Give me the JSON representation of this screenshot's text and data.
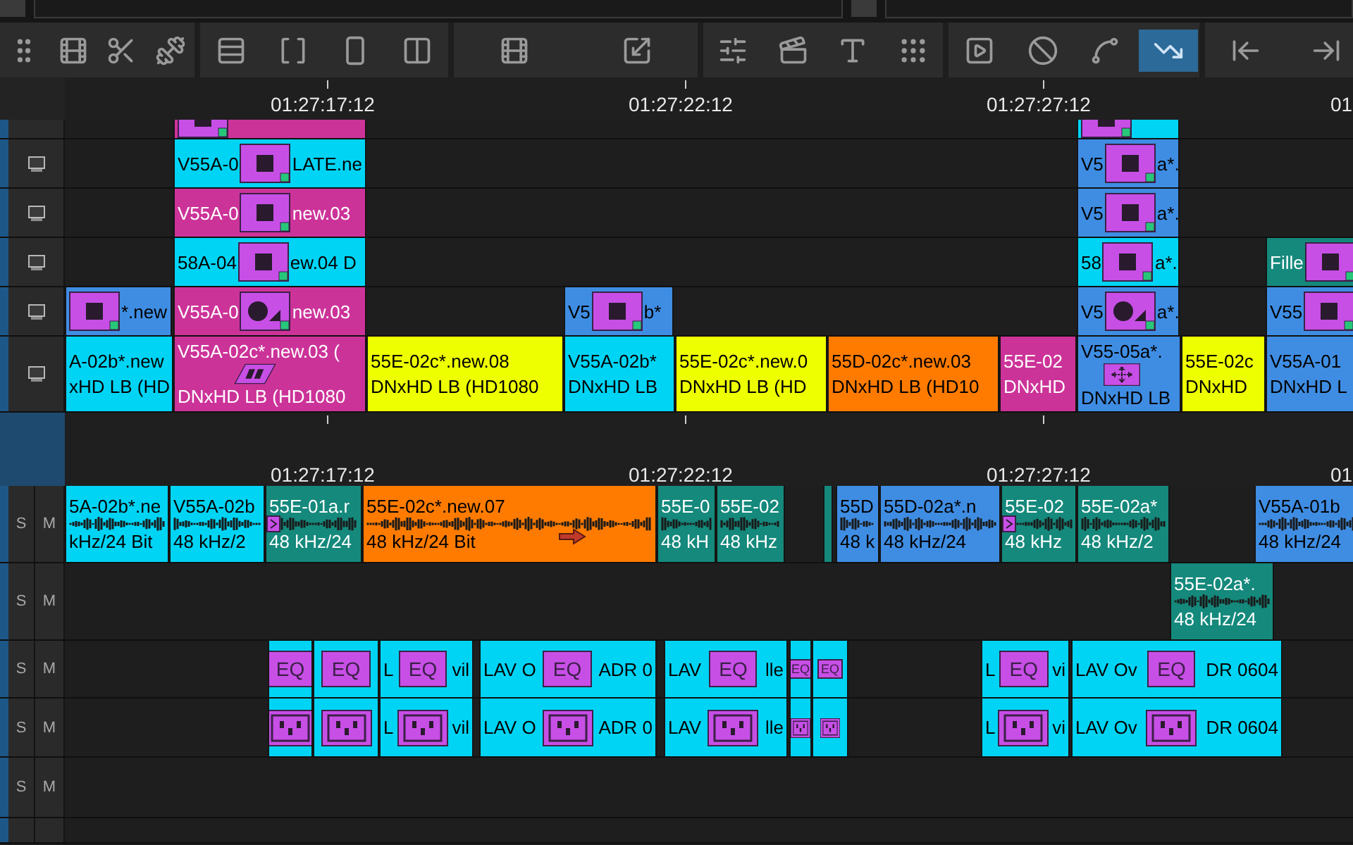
{
  "toolbar": {
    "groups": [
      [
        {
          "selected": false
        },
        {
          "selected": false
        },
        {
          "selected": false
        },
        {
          "selected": false
        }
      ],
      [
        {
          "selected": false
        },
        {
          "selected": false
        },
        {
          "selected": false
        },
        {
          "selected": false
        }
      ],
      [
        {
          "selected": false
        },
        {
          "selected": false
        }
      ],
      [
        {
          "selected": false
        },
        {
          "selected": false
        },
        {
          "selected": false
        },
        {
          "selected": false
        }
      ],
      [
        {
          "selected": false
        },
        {
          "selected": false
        },
        {
          "selected": false
        },
        {
          "selected": true
        }
      ],
      [
        {
          "selected": false
        },
        {
          "selected": false
        }
      ]
    ]
  },
  "ruler_top": {
    "timecodes": [
      "01:27:17:12",
      "01:27:22:12",
      "01:27:27:12",
      "01"
    ]
  },
  "video_tracks": [
    {
      "clips": [
        {
          "kind": "effect",
          "color": "#cc3399"
        },
        {
          "kind": "effect",
          "color": "#00d4f5"
        }
      ]
    },
    {
      "clips": [
        {
          "kind": "effect",
          "color": "#00d4f5",
          "before": "V55A-0",
          "after": "LATE.ne"
        },
        {
          "kind": "effect",
          "color": "#3f8de3",
          "before": "V5",
          "after": "a*."
        }
      ]
    },
    {
      "clips": [
        {
          "kind": "effect",
          "color": "#cc3399",
          "before": "V55A-0",
          "after": "new.03"
        },
        {
          "kind": "effect",
          "color": "#3f8de3",
          "before": "V5",
          "after": "a*."
        }
      ]
    },
    {
      "clips": [
        {
          "kind": "effect",
          "color": "#00d4f5",
          "before": "58A-04",
          "after": "ew.04 D"
        },
        {
          "kind": "effect",
          "color": "#00d4f5",
          "before": "58",
          "after": "a*."
        },
        {
          "kind": "effect",
          "color": "#14897c",
          "before": "Fille"
        }
      ]
    },
    {
      "clips": [
        {
          "kind": "effect",
          "color": "#3f8de3",
          "after": "*.new"
        },
        {
          "kind": "effect",
          "color": "#cc3399",
          "before": "V55A-0",
          "after": "new.03"
        },
        {
          "kind": "effect",
          "color": "#3f8de3",
          "before": "V5",
          "after": "b*"
        },
        {
          "kind": "effect",
          "color": "#3f8de3",
          "before": "V5",
          "after": "a*."
        },
        {
          "kind": "effect",
          "color": "#3f8de3",
          "before": "V55"
        }
      ]
    },
    {
      "clips": [
        {
          "kind": "media",
          "color": "#00d4f5",
          "lines": [
            "A-02b*.new",
            "xHD LB (HD"
          ]
        },
        {
          "kind": "media",
          "color": "#cc3399",
          "lines": [
            "V55A-02c*.new.03 (",
            "DNxHD LB (HD1080"
          ]
        },
        {
          "kind": "media",
          "color": "#eeff00",
          "lines": [
            "55E-02c*.new.08",
            "DNxHD LB (HD1080"
          ]
        },
        {
          "kind": "media",
          "color": "#00d4f5",
          "lines": [
            "V55A-02b*",
            "DNxHD LB"
          ]
        },
        {
          "kind": "media",
          "color": "#eeff00",
          "lines": [
            "55E-02c*.new.0",
            "DNxHD LB (HD"
          ]
        },
        {
          "kind": "media",
          "color": "#ff7b00",
          "lines": [
            "55D-02c*.new.03",
            "DNxHD LB (HD10"
          ]
        },
        {
          "kind": "media",
          "color": "#cc3399",
          "lines": [
            "55E-02",
            "DNxHD"
          ]
        },
        {
          "kind": "media",
          "color": "#3f8de3",
          "lines": [
            "V55-05a*.",
            "DNxHD LB"
          ]
        },
        {
          "kind": "media",
          "color": "#eeff00",
          "lines": [
            "55E-02c",
            "DNxHD"
          ]
        },
        {
          "kind": "media",
          "color": "#3f8de3",
          "lines": [
            "V55A-01",
            "DNxHD L"
          ]
        }
      ]
    }
  ],
  "ruler_bottom": {
    "timecodes": [
      "01:27:17:12",
      "01:27:22:12",
      "01:27:27:12",
      "01"
    ]
  },
  "audio_tracks": [
    {
      "solo": "S",
      "mute": "M",
      "clips": [
        {
          "kind": "audio",
          "color": "#00d4f5",
          "lines": [
            "5A-02b*.ne",
            "kHz/24 Bit"
          ]
        },
        {
          "kind": "audio",
          "color": "#00d4f5",
          "lines": [
            "V55A-02b",
            "48 kHz/2"
          ]
        },
        {
          "kind": "audio",
          "color": "#14897c",
          "lines": [
            "55E-01a.r",
            "48 kHz/24"
          ]
        },
        {
          "kind": "audio",
          "color": "#ff7b00",
          "lines": [
            "55E-02c*.new.07",
            "48 kHz/24 Bit"
          ]
        },
        {
          "kind": "audio",
          "color": "#14897c",
          "lines": [
            "55E-0",
            "48 kH"
          ]
        },
        {
          "kind": "audio",
          "color": "#14897c",
          "lines": [
            "55E-02",
            "48 kHz"
          ]
        },
        {
          "kind": "audio",
          "color": "#14897c"
        },
        {
          "kind": "audio",
          "color": "#3f8de3",
          "lines": [
            "55D",
            "48 k"
          ]
        },
        {
          "kind": "audio",
          "color": "#3f8de3",
          "lines": [
            "55D-02a*.n",
            "48 kHz/24"
          ]
        },
        {
          "kind": "audio",
          "color": "#14897c",
          "lines": [
            "55E-02",
            "48 kHz"
          ]
        },
        {
          "kind": "audio",
          "color": "#14897c",
          "lines": [
            "55E-02a*",
            "48 kHz/2"
          ]
        },
        {
          "kind": "audio",
          "color": "#3f8de3",
          "lines": [
            "V55A-01b",
            "48 kHz/24"
          ]
        }
      ]
    },
    {
      "solo": "S",
      "mute": "M",
      "clips": [
        {
          "kind": "audio",
          "color": "#14897c",
          "lines": [
            "55E-02a*.",
            "48 kHz/24"
          ]
        }
      ]
    },
    {
      "solo": "S",
      "mute": "M",
      "clips": [
        {
          "kind": "eq",
          "color": "#00d4f5",
          "label": "EQ"
        },
        {
          "kind": "eq",
          "color": "#00d4f5",
          "label": "EQ"
        },
        {
          "kind": "eq",
          "color": "#00d4f5",
          "label": "EQ",
          "before": "L",
          "after": "vil"
        },
        {
          "kind": "eq",
          "color": "#00d4f5",
          "label": "EQ",
          "before": "LAV O",
          "after": "ADR 0"
        },
        {
          "kind": "eq",
          "color": "#00d4f5",
          "label": "EQ",
          "before": "LAV",
          "after": "lle"
        },
        {
          "kind": "eq",
          "color": "#00d4f5",
          "label": "EQ"
        },
        {
          "kind": "eq",
          "color": "#00d4f5",
          "label": "EQ"
        },
        {
          "kind": "eq",
          "color": "#00d4f5",
          "label": "EQ",
          "before": "L",
          "after": "vi"
        },
        {
          "kind": "eq",
          "color": "#00d4f5",
          "label": "EQ",
          "before": "LAV Ov",
          "after": "DR 0604"
        }
      ]
    },
    {
      "solo": "S",
      "mute": "M",
      "clips": [
        {
          "kind": "insert",
          "color": "#00d4f5"
        },
        {
          "kind": "insert",
          "color": "#00d4f5"
        },
        {
          "kind": "insert",
          "color": "#00d4f5",
          "before": "L",
          "after": "vil"
        },
        {
          "kind": "insert",
          "color": "#00d4f5",
          "before": "LAV O",
          "after": "ADR 0"
        },
        {
          "kind": "insert",
          "color": "#00d4f5",
          "before": "LAV",
          "after": "lle"
        },
        {
          "kind": "insert",
          "color": "#00d4f5"
        },
        {
          "kind": "insert",
          "color": "#00d4f5"
        },
        {
          "kind": "insert",
          "color": "#00d4f5",
          "before": "L",
          "after": "vi"
        },
        {
          "kind": "insert",
          "color": "#00d4f5",
          "before": "LAV Ov",
          "after": "DR 0604"
        }
      ]
    },
    {
      "solo": "S",
      "mute": "M"
    }
  ]
}
